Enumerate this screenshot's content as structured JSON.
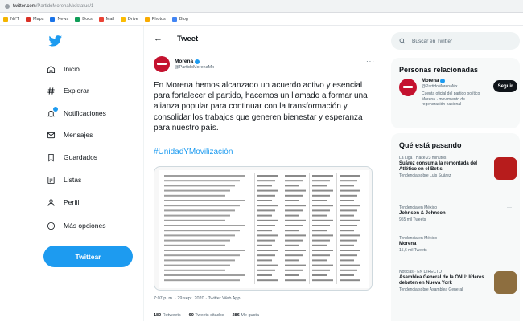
{
  "browser": {
    "url_domain": "twitter.com",
    "url_path": "/PartidoMorenaMx/status/1"
  },
  "bookmarks": [
    {
      "label": "NYT",
      "color": "#f4b400"
    },
    {
      "label": "Maps",
      "color": "#d93025"
    },
    {
      "label": "News",
      "color": "#1a73e8"
    },
    {
      "label": "Docs",
      "color": "#0f9d58"
    },
    {
      "label": "Mail",
      "color": "#ea4335"
    },
    {
      "label": "Drive",
      "color": "#fbbc04"
    },
    {
      "label": "Photos",
      "color": "#f9ab00"
    },
    {
      "label": "Blog",
      "color": "#4285f4"
    }
  ],
  "nav": {
    "items": [
      {
        "label": "Inicio",
        "icon": "home-icon"
      },
      {
        "label": "Explorar",
        "icon": "hashtag-icon"
      },
      {
        "label": "Notificaciones",
        "icon": "bell-icon"
      },
      {
        "label": "Mensajes",
        "icon": "mail-icon"
      },
      {
        "label": "Guardados",
        "icon": "bookmark-icon"
      },
      {
        "label": "Listas",
        "icon": "list-icon"
      },
      {
        "label": "Perfil",
        "icon": "person-icon"
      },
      {
        "label": "Más opciones",
        "icon": "more-options-icon"
      }
    ],
    "tweet_button": "Twittear"
  },
  "header": {
    "back_glyph": "←",
    "title": "Tweet"
  },
  "tweet": {
    "author_name": "Morena",
    "author_handle": "@PartidoMorenaMx",
    "text": "En Morena hemos alcanzado un acuerdo activo y esencial para fortalecer el partido, hacemos un llamado a formar una alianza popular para continuar con la transformación y consolidar los trabajos que generen bienestar y esperanza para nuestro país.",
    "hashtag": "#UnidadYMovilización",
    "meta": "7:07 p. m. · 29 sept. 2020 · Twitter Web App",
    "stats": [
      {
        "count": "180",
        "label": "Retweets"
      },
      {
        "count": "60",
        "label": "Tweets citados"
      },
      {
        "count": "286",
        "label": "Me gusta"
      }
    ]
  },
  "search": {
    "placeholder": "Buscar en Twitter"
  },
  "related": {
    "title": "Personas relacionadas",
    "name": "Morena",
    "handle": "@PartidoMorenaMx",
    "bio": "Cuenta oficial del partido político Morena · movimiento de regeneración nacional",
    "follow": "Seguir"
  },
  "trends": {
    "title": "Qué está pasando",
    "items": [
      {
        "category": "La Liga · Hace 23 minutos",
        "title": "Suárez consuma la remontada del Atlético en el Betis",
        "sub": "Tendencia sobre Luis Suárez",
        "thumb": "#b71c1c"
      },
      {
        "category": "Tendencia en México",
        "title": "Johnson & Johnson",
        "sub": "955 mil Tweets",
        "thumb": ""
      },
      {
        "category": "Tendencia en México",
        "title": "Morena",
        "sub": "15,6 mil Tweets",
        "thumb": ""
      },
      {
        "category": "Noticias · EN DIRECTO",
        "title": "Asamblea General de la ONU: líderes debaten en Nueva York",
        "sub": "Tendencia sobre Asamblea General",
        "thumb": "#8d6e3f"
      }
    ]
  }
}
